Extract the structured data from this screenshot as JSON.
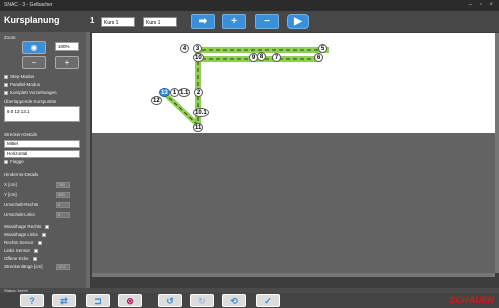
{
  "window": {
    "title": "SNAC - 3 - Gelbacher",
    "controls": "– ▫ ×"
  },
  "header": {
    "title": "Kursplanung",
    "course_no": "1",
    "course_select": "Kurs 1",
    "course_name": "Kurs 1"
  },
  "toolbar": {
    "arrow": "➡",
    "plus": "+",
    "minus": "−",
    "play": "▶"
  },
  "left": {
    "zoom_label": "Zoom",
    "zoom_value": "100%",
    "options": [
      "Step-Modus",
      "Parallel-Modus",
      "Komplett Vorziehungen"
    ],
    "overlap_label": "Überlappende Kurspunkte",
    "overlap_value": "9.0   13   13.1",
    "route_label": "Strecken-Details",
    "route_select1": "Mittel",
    "route_select2": "Horizontal",
    "route_flag": "Flagge",
    "props_label": "Hindernis-Details",
    "props": [
      {
        "label": "X [cm]",
        "value": "750"
      },
      {
        "label": "Y [cm]",
        "value": "400"
      },
      {
        "label": "Umschalt-Rechts",
        "value": "0"
      },
      {
        "label": "Umschalt-Links",
        "value": "0"
      }
    ],
    "checks": [
      "Wassihage Rechts",
      "Wassihage Links",
      "Rechts Sensor",
      "Links Sensor",
      "Offene Ecke"
    ],
    "stretch_label": "Streckenlänge [cm]",
    "stretch_value": "12.0"
  },
  "nodes": [
    "4",
    "3",
    "5",
    "10",
    "9",
    "8",
    "7",
    "6",
    "13",
    "1",
    "1.1",
    "2",
    "12",
    "10.1",
    "11"
  ],
  "status": "Status: bereit",
  "footer": {
    "help": "?",
    "b2": "⇄",
    "b3": "⊐",
    "b4": "⊗",
    "b5": "↺",
    "b6": "↻",
    "b7": "⟲",
    "b8": "✓",
    "brand": "SCHAUER"
  }
}
